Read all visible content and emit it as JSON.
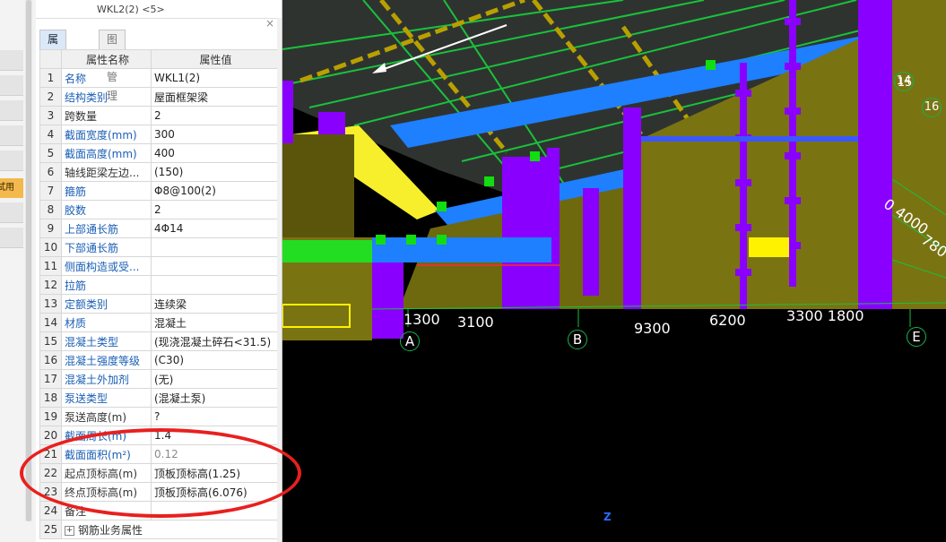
{
  "panel": {
    "prev_item": "WKL2(2) <5>",
    "close_glyph": "×",
    "tabs": [
      "属性列表",
      "图层管理"
    ],
    "header": {
      "num": "",
      "name": "属性名称",
      "value": "属性值"
    },
    "rows": [
      {
        "num": "1",
        "name": "名称",
        "value": "WKL1(2)",
        "blue": true
      },
      {
        "num": "2",
        "name": "结构类别",
        "value": "屋面框架梁",
        "blue": true
      },
      {
        "num": "3",
        "name": "跨数量",
        "value": "2",
        "blue": false
      },
      {
        "num": "4",
        "name": "截面宽度(mm)",
        "value": "300",
        "blue": true
      },
      {
        "num": "5",
        "name": "截面高度(mm)",
        "value": "400",
        "blue": true
      },
      {
        "num": "6",
        "name": "轴线距梁左边...",
        "value": "(150)",
        "blue": false
      },
      {
        "num": "7",
        "name": "箍筋",
        "value": "Φ8@100(2)",
        "blue": true
      },
      {
        "num": "8",
        "name": "胶数",
        "value": "2",
        "blue": true
      },
      {
        "num": "9",
        "name": "上部通长筋",
        "value": "4Φ14",
        "blue": true
      },
      {
        "num": "10",
        "name": "下部通长筋",
        "value": "",
        "blue": true
      },
      {
        "num": "11",
        "name": "侧面构造或受...",
        "value": "",
        "blue": true
      },
      {
        "num": "12",
        "name": "拉筋",
        "value": "",
        "blue": true
      },
      {
        "num": "13",
        "name": "定额类别",
        "value": "连续梁",
        "blue": true
      },
      {
        "num": "14",
        "name": "材质",
        "value": "混凝土",
        "blue": true
      },
      {
        "num": "15",
        "name": "混凝土类型",
        "value": "(现浇混凝土碎石<31.5)",
        "blue": true
      },
      {
        "num": "16",
        "name": "混凝土强度等级",
        "value": "(C30)",
        "blue": true
      },
      {
        "num": "17",
        "name": "混凝土外加剂",
        "value": "(无)",
        "blue": true
      },
      {
        "num": "18",
        "name": "泵送类型",
        "value": "(混凝土泵)",
        "blue": true
      },
      {
        "num": "19",
        "name": "泵送高度(m)",
        "value": "?",
        "blue": false
      },
      {
        "num": "20",
        "name": "截面周长(m)",
        "value": "1.4",
        "blue": true
      },
      {
        "num": "21",
        "name": "截面面积(m²)",
        "value": "0.12",
        "blue": true,
        "gray": true
      },
      {
        "num": "22",
        "name": "起点顶标高(m)",
        "value": "顶板顶标高(1.25)",
        "blue": false
      },
      {
        "num": "23",
        "name": "终点顶标高(m)",
        "value": "顶板顶标高(6.076)",
        "blue": false
      },
      {
        "num": "24",
        "name": "备注",
        "value": "",
        "blue": false
      },
      {
        "num": "25",
        "name": "钢筋业务属性",
        "value": "",
        "blue": false,
        "expand": "+"
      }
    ]
  },
  "sidebar": {
    "trial_label": "试用"
  },
  "viewport": {
    "dims": [
      "1300",
      "3100",
      "9300",
      "6200",
      "3300 1800"
    ],
    "dims_right": [
      "0 4000",
      "780"
    ],
    "axes": [
      "A",
      "B",
      "E",
      "14",
      "15",
      "16"
    ],
    "z_label": "Z",
    "colors": {
      "wall": "#7a7312",
      "column": "#8a00ff",
      "beam": "#1e7fff",
      "slab": "#2f3330",
      "highlight": "#fff200",
      "node": "#11dd11",
      "grid": "#19c23b",
      "ring": "#e8201e"
    }
  }
}
